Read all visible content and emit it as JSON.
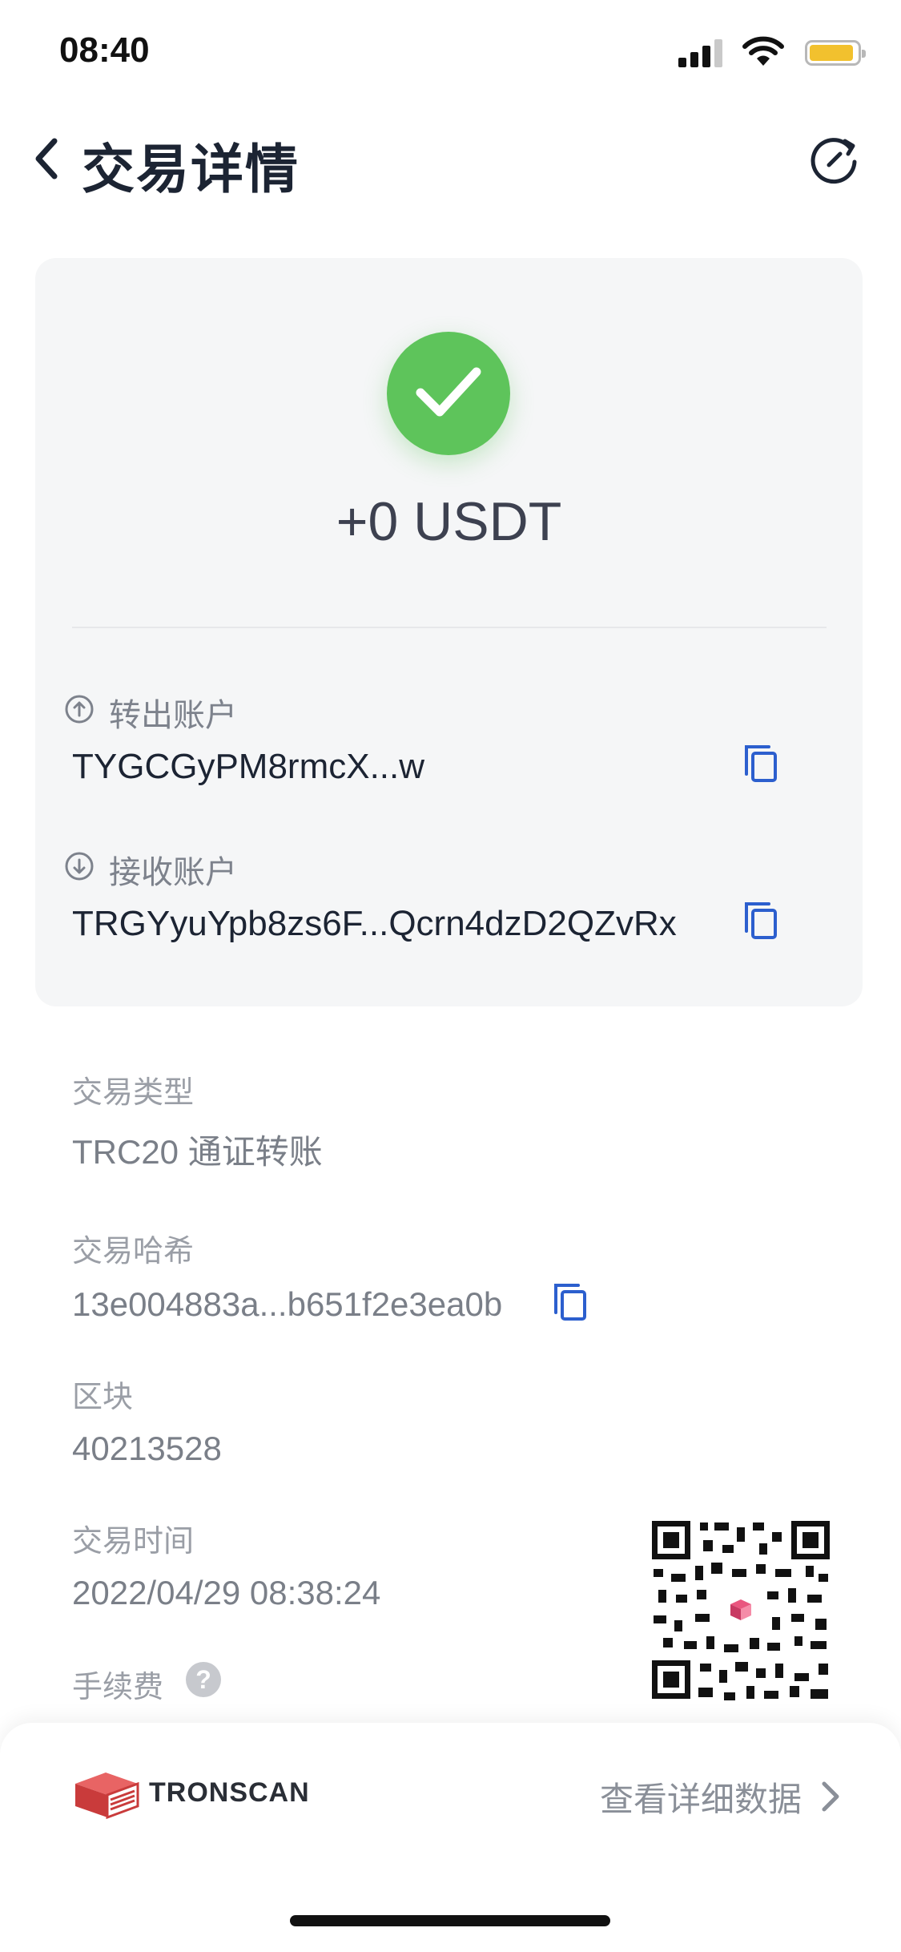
{
  "status_bar": {
    "time": "08:40"
  },
  "header": {
    "title": "交易详情"
  },
  "summary": {
    "amount": "+0 USDT",
    "from_label": "转出账户",
    "from_address": "TYGCGyPM8rmcX...w",
    "to_label": "接收账户",
    "to_address": "TRGYyuYpb8zs6F...Qcrn4dzD2QZvRx"
  },
  "details": {
    "type_label": "交易类型",
    "type_value": "TRC20 通证转账",
    "hash_label": "交易哈希",
    "hash_value": "13e004883a...b651f2e3ea0b",
    "block_label": "区块",
    "block_value": "40213528",
    "time_label": "交易时间",
    "time_value": "2022/04/29 08:38:24",
    "fee_label": "手续费",
    "help_glyph": "?"
  },
  "footer": {
    "brand": "TRONSCAN",
    "view_details": "查看详细数据"
  },
  "colors": {
    "success": "#5ec45b",
    "copy_icon": "#2c5fce",
    "title": "#1c2433",
    "card_bg": "#f5f6f7"
  }
}
